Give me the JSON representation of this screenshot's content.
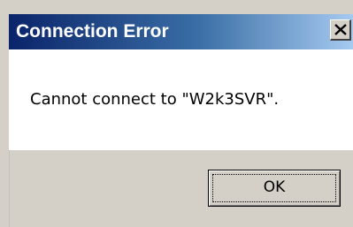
{
  "dialog": {
    "title": "Connection Error",
    "message": "Cannot connect to \"W2k3SVR\".",
    "ok_label": "OK",
    "close_icon": "close-icon"
  },
  "colors": {
    "titlebar_start": "#0a246a",
    "titlebar_end": "#a6caf0",
    "dialog_face": "#d4d0c8",
    "content_background": "#ffffff"
  }
}
